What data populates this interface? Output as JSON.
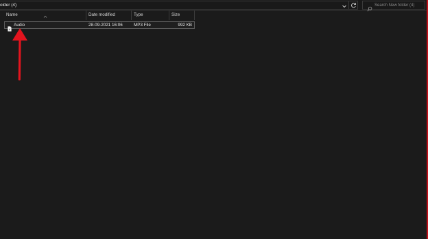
{
  "address_bar": {
    "text": "older (4)"
  },
  "search": {
    "placeholder": "Search New folder (4)"
  },
  "columns": {
    "name": "Name",
    "date_modified": "Date modified",
    "type": "Type",
    "size": "Size"
  },
  "files": [
    {
      "name": "Audio",
      "date_modified": "28-09-2021 16:06",
      "type": "MP3 File",
      "size": "992 KB"
    }
  ],
  "colors": {
    "background": "#1b1b1b",
    "annotation_arrow": "#e3141e",
    "right_border": "#c1121b"
  }
}
